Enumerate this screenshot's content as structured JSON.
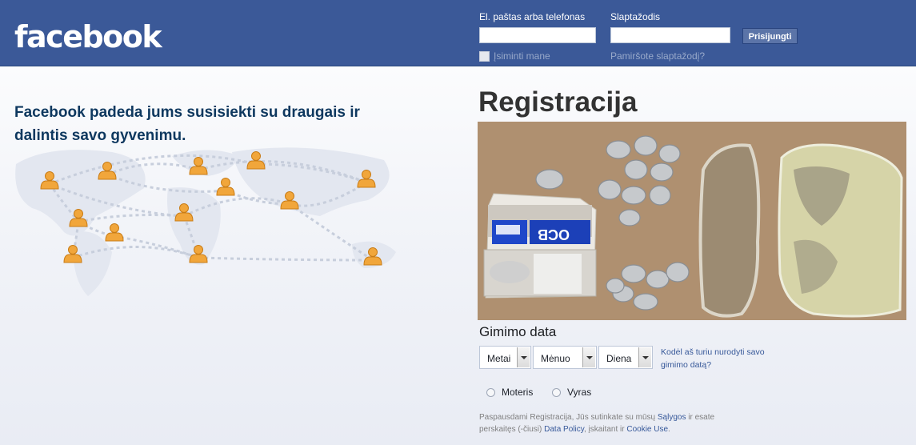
{
  "header": {
    "logo": "facebook",
    "email_label": "El. paštas arba telefonas",
    "password_label": "Slaptažodis",
    "email_value": "",
    "password_value": "",
    "login_button": "Prisijungti",
    "remember_label": "Įsiminti mane",
    "forgot_link": "Pamiršote slaptažodį?"
  },
  "left": {
    "tagline": "Facebook padeda jums susisiekti su draugais ir dalintis savo gyvenimu."
  },
  "register": {
    "title": "Registracija",
    "birthday_title": "Gimimo data",
    "year_select": "Metai",
    "month_select": "Mėnuo",
    "day_select": "Diena",
    "why_link": "Kodėl aš turiu nurodyti savo gimimo datą?",
    "gender_female": "Moteris",
    "gender_male": "Vyras",
    "terms_prefix": "Paspausdami Registracija, Jūs sutinkate su mūsų",
    "terms_link": "Sąlygos",
    "terms_middle1": "ir esate perskaitęs (-čiusi)",
    "data_policy_link": "Data Policy",
    "terms_middle2": ", įskaitant ir",
    "cookie_link": "Cookie Use",
    "terms_end": "."
  },
  "colors": {
    "header_bg": "#3b5998",
    "link": "#365899",
    "tagline": "#0e385f",
    "person_icon": "#f1a63b"
  },
  "icons": [
    "person-icon",
    "world-map"
  ]
}
